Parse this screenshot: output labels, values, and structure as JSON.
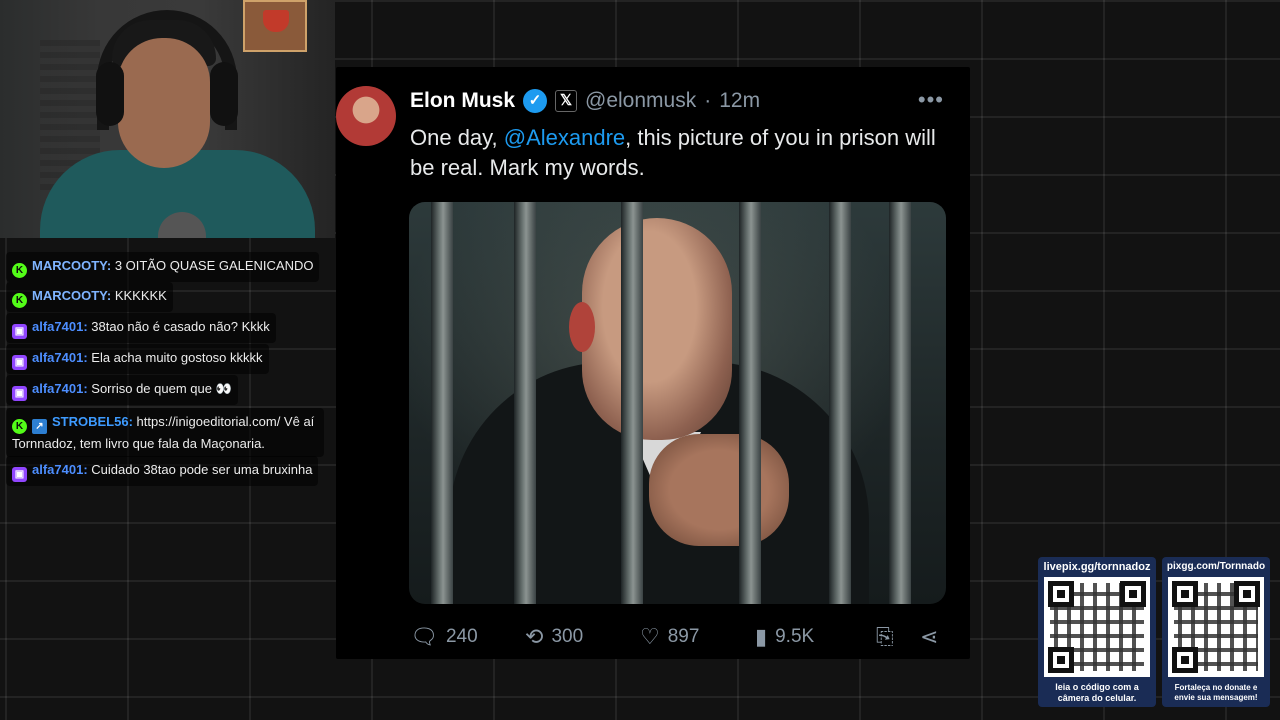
{
  "chat": {
    "messages": [
      {
        "badge": "kick",
        "user": "MARCOOTY",
        "text": "3 OITÃO QUASE GALENICANDO"
      },
      {
        "badge": "kick",
        "user": "MARCOOTY",
        "text": "KKKKKK"
      },
      {
        "badge": "twitch",
        "user": "alfa7401",
        "text": "38tao não é casado não? Kkkk"
      },
      {
        "badge": "twitch",
        "user": "alfa7401",
        "text": "Ela acha muito gostoso kkkkk"
      },
      {
        "badge": "twitch",
        "user": "alfa7401",
        "text": "Sorriso de quem que 👀"
      },
      {
        "badge": "kick",
        "user": "STROBEL56",
        "text": "https://inigoeditorial.com/ Vê aí Tornnadoz, tem livro que fala da Maçonaria."
      },
      {
        "badge": "twitch",
        "user": "alfa7401",
        "text": "Cuidado 38tao pode ser uma bruxinha"
      }
    ]
  },
  "tweet": {
    "name": "Elon Musk",
    "handle": "@elonmusk",
    "separator": "·",
    "time": "12m",
    "more": "•••",
    "text_before": "One day, ",
    "mention": "@Alexandre",
    "text_after": ", this picture of you in prison will be real. Mark my words.",
    "replies": "240",
    "retweets": "300",
    "likes": "897",
    "views": "9.5K",
    "accent": "#1d9bf0"
  },
  "donate": {
    "livepix": {
      "title": "livepix.gg/tornnadoz",
      "footer": "leia o código com a câmera do celular."
    },
    "pixgg": {
      "title": "pixgg.com/Tornnado",
      "footer": "Fortaleça no donate e envie sua mensagem!"
    }
  }
}
